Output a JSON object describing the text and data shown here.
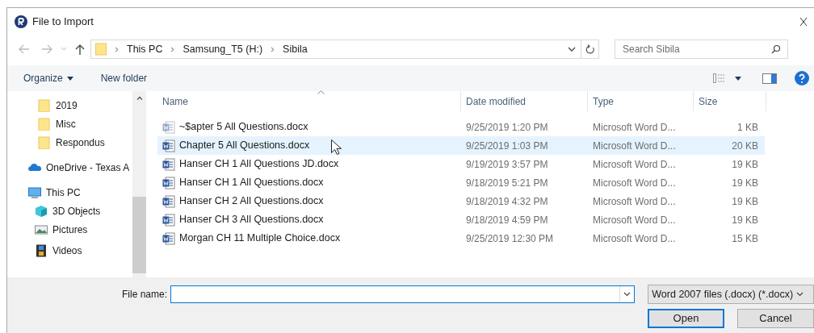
{
  "window": {
    "title": "File to Import"
  },
  "address_bar": {
    "path": [
      "This PC",
      "Samsung_T5 (H:)",
      "Sibila"
    ]
  },
  "search": {
    "placeholder": "Search Sibila"
  },
  "toolbar": {
    "organize": "Organize",
    "new_folder": "New folder"
  },
  "sidebar": {
    "items": [
      {
        "label": "2019",
        "kind": "folder"
      },
      {
        "label": "Misc",
        "kind": "folder"
      },
      {
        "label": "Respondus",
        "kind": "folder"
      },
      {
        "label": "OneDrive - Texas A",
        "kind": "cloud"
      },
      {
        "label": "This PC",
        "kind": "pc"
      },
      {
        "label": "3D Objects",
        "kind": "cube"
      },
      {
        "label": "Pictures",
        "kind": "pictures"
      },
      {
        "label": "Videos",
        "kind": "videos"
      }
    ]
  },
  "table": {
    "columns": [
      "Name",
      "Date modified",
      "Type",
      "Size"
    ],
    "rows": [
      {
        "name": "~$apter 5 All Questions.docx",
        "date": "9/25/2019 1:20 PM",
        "type": "Microsoft Word D...",
        "size": "1 KB",
        "hidden": true,
        "selected": false
      },
      {
        "name": "Chapter 5 All Questions.docx",
        "date": "9/25/2019 1:03 PM",
        "type": "Microsoft Word D...",
        "size": "20 KB",
        "hidden": false,
        "selected": true
      },
      {
        "name": "Hanser CH 1 All Questions JD.docx",
        "date": "9/19/2019 3:57 PM",
        "type": "Microsoft Word D...",
        "size": "19 KB",
        "hidden": false,
        "selected": false
      },
      {
        "name": "Hanser CH 1 All Questions.docx",
        "date": "9/18/2019 5:21 PM",
        "type": "Microsoft Word D...",
        "size": "19 KB",
        "hidden": false,
        "selected": false
      },
      {
        "name": "Hanser CH 2 All Questions.docx",
        "date": "9/18/2019 4:32 PM",
        "type": "Microsoft Word D...",
        "size": "19 KB",
        "hidden": false,
        "selected": false
      },
      {
        "name": "Hanser CH 3 All Questions.docx",
        "date": "9/18/2019 4:59 PM",
        "type": "Microsoft Word D...",
        "size": "19 KB",
        "hidden": false,
        "selected": false
      },
      {
        "name": "Morgan CH 11 Multiple Choice.docx",
        "date": "9/25/2019 12:30 PM",
        "type": "Microsoft Word D...",
        "size": "15 KB",
        "hidden": false,
        "selected": false
      }
    ]
  },
  "file_name": {
    "label": "File name:"
  },
  "file_type": {
    "value": "Word 2007 files (.docx) (*.docx)"
  },
  "buttons": [
    "Open",
    "Cancel"
  ]
}
